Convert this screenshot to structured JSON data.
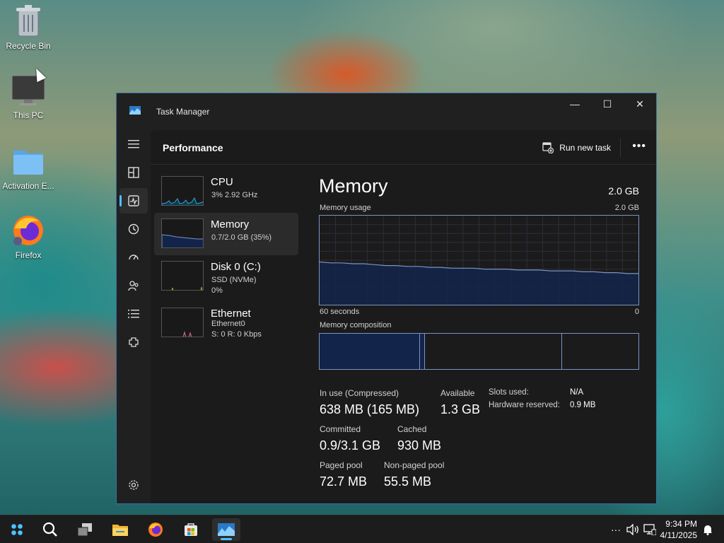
{
  "desktop": {
    "icons": [
      {
        "label": "Recycle Bin"
      },
      {
        "label": "This PC"
      },
      {
        "label": "Activation E..."
      },
      {
        "label": "Firefox"
      }
    ]
  },
  "window": {
    "title": "Task Manager",
    "minimize": "—",
    "maximize": "☐",
    "close": "✕"
  },
  "nav": {
    "items": [
      {
        "name": "menu-icon"
      },
      {
        "name": "processes-icon"
      },
      {
        "name": "performance-icon",
        "active": true
      },
      {
        "name": "app-history-icon"
      },
      {
        "name": "startup-apps-icon"
      },
      {
        "name": "users-icon"
      },
      {
        "name": "details-icon"
      },
      {
        "name": "services-icon"
      },
      {
        "name": "settings-icon"
      }
    ]
  },
  "header": {
    "page_title": "Performance",
    "run_new_task": "Run new task",
    "more": "•••"
  },
  "resources": [
    {
      "name": "CPU",
      "line1": "3% 2.92 GHz",
      "line2": ""
    },
    {
      "name": "Memory",
      "line1": "0.7/2.0 GB (35%)",
      "line2": "",
      "selected": true
    },
    {
      "name": "Disk 0 (C:)",
      "line1": "SSD (NVMe)",
      "line2": "0%"
    },
    {
      "name": "Ethernet",
      "line1": "Ethernet0",
      "line2": "S: 0 R: 0 Kbps"
    }
  ],
  "memory": {
    "title": "Memory",
    "total": "2.0 GB",
    "usage_label": "Memory usage",
    "usage_max": "2.0 GB",
    "graph_left": "60 seconds",
    "graph_right": "0",
    "usage_history_pct": [
      48,
      47,
      47,
      46,
      46,
      45,
      44,
      44,
      43,
      43,
      42,
      42,
      41,
      41,
      41,
      40,
      40,
      40,
      39,
      39,
      39,
      38,
      38,
      38,
      37,
      37,
      36,
      36,
      35,
      35
    ],
    "composition_label": "Memory composition",
    "composition_pct": {
      "in_use": 31.5,
      "modified": 1.5,
      "standby": 43,
      "free": 24
    },
    "stats": {
      "in_use_label": "In use (Compressed)",
      "in_use_value": "638 MB (165 MB)",
      "available_label": "Available",
      "available_value": "1.3 GB",
      "committed_label": "Committed",
      "committed_value": "0.9/3.1 GB",
      "cached_label": "Cached",
      "cached_value": "930 MB",
      "paged_label": "Paged pool",
      "paged_value": "72.7 MB",
      "nonpaged_label": "Non-paged pool",
      "nonpaged_value": "55.5 MB",
      "slots_label": "Slots used:",
      "slots_value": "N/A",
      "hw_reserved_label": "Hardware reserved:",
      "hw_reserved_value": "0.9 MB"
    }
  },
  "taskbar": {
    "time": "9:34 PM",
    "date": "4/11/2025",
    "overflow": "···"
  },
  "colors": {
    "accent": "#4cc2ff",
    "memory_line": "#7b93c7",
    "memory_fill": "#13244a"
  }
}
